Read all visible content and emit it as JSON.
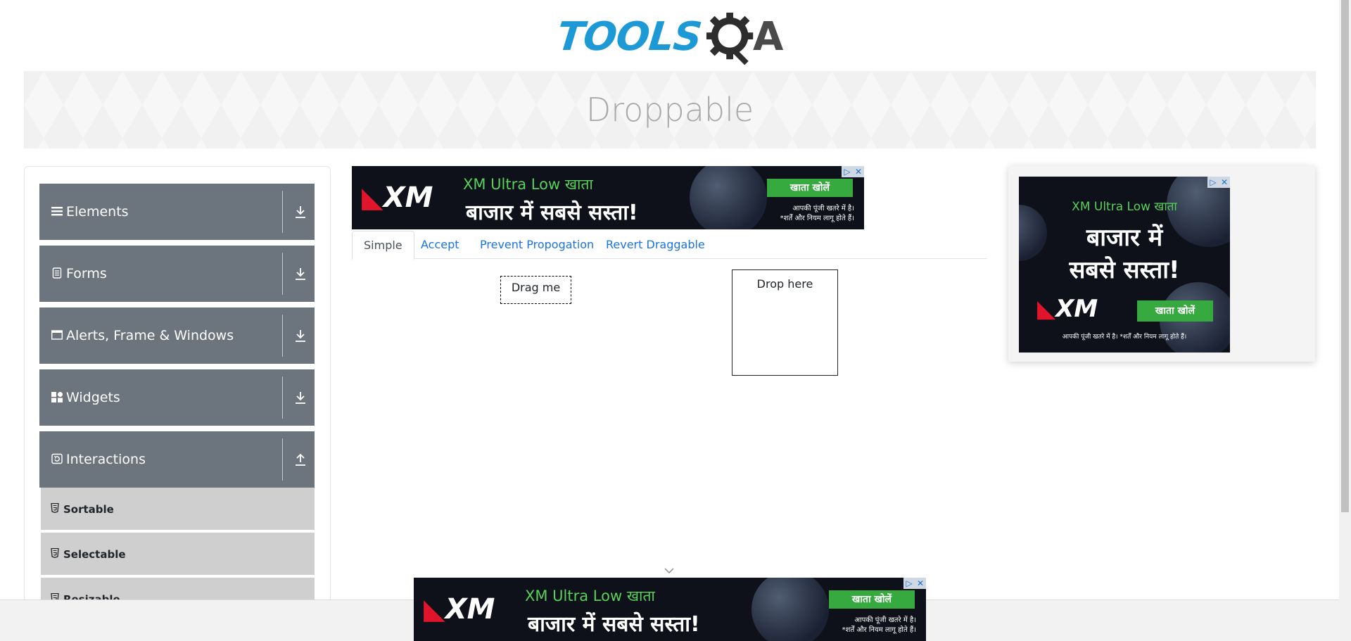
{
  "header": {
    "logo_text": "TOOLS",
    "logo_suffix": "A"
  },
  "banner": {
    "title": "Droppable"
  },
  "sidebar": {
    "groups": [
      {
        "label": "Elements",
        "icon": "hamburger-icon",
        "state": "collapsed"
      },
      {
        "label": "Forms",
        "icon": "document-icon",
        "state": "collapsed"
      },
      {
        "label": "Alerts, Frame & Windows",
        "icon": "window-icon",
        "state": "collapsed"
      },
      {
        "label": "Widgets",
        "icon": "grid-icon",
        "state": "collapsed"
      },
      {
        "label": "Interactions",
        "icon": "refresh-icon",
        "state": "expanded"
      }
    ],
    "interaction_items": [
      {
        "label": "Sortable"
      },
      {
        "label": "Selectable"
      },
      {
        "label": "Resizable"
      }
    ]
  },
  "ad": {
    "headline": "XM Ultra Low खाता",
    "big_text": "बाजार में सबसे सस्ता!",
    "big_line1": "बाजार में",
    "big_line2": "सबसे सस्ता!",
    "cta": "खाता खोलें",
    "disclaimer_line1": "आपकी पूंजी खतरे में है।",
    "disclaimer_line2": "*शर्तें और नियम लागू होते हैं।",
    "disclaimer_single": "आपकी पूंजी खतरे में है। *शर्तें और नियम लागू होते हैं।",
    "brand": "XM",
    "choice_info": "▷",
    "choice_close": "✕"
  },
  "tabs": [
    {
      "label": "Simple",
      "active": true
    },
    {
      "label": "Accept",
      "active": false
    },
    {
      "label": "Prevent Propogation",
      "active": false
    },
    {
      "label": "Revert Draggable",
      "active": false
    }
  ],
  "demo": {
    "drag_label": "Drag me",
    "drop_label": "Drop here"
  },
  "colors": {
    "brand_blue": "#1d9ad6",
    "sidebar_group": "#6c757d",
    "subitem_bg": "#cfcfcf",
    "link_blue": "#1a73e8",
    "ad_green": "#36a93f"
  }
}
